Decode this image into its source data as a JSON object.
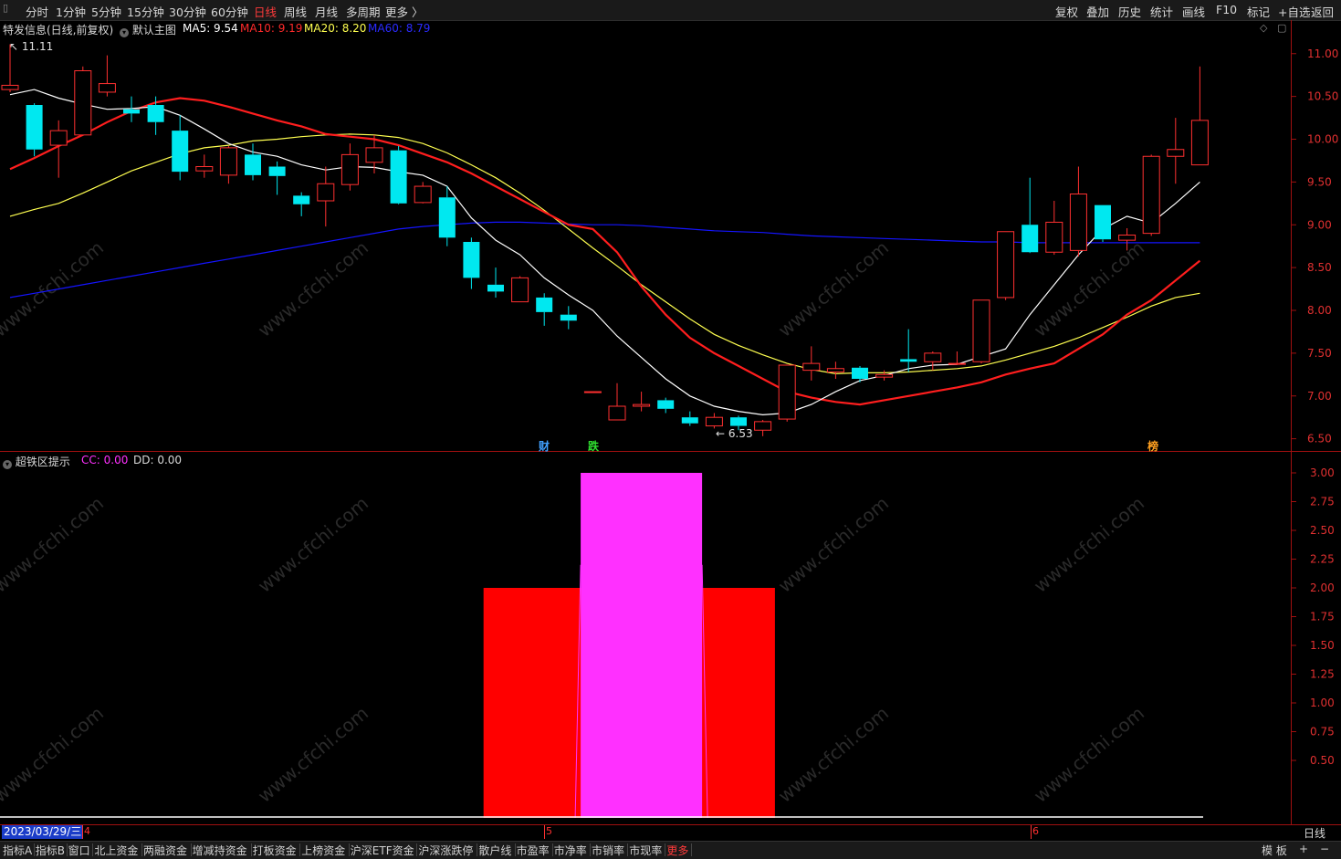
{
  "colors": {
    "up": "#ff3030",
    "down": "#00e8f0",
    "ma5": "#ffffff",
    "ma10": "#ff1e1e",
    "ma20": "#ffff50",
    "ma60": "#1414ff",
    "cc": "#ff30ff",
    "dd": "#ff0000",
    "axis": "#a01010",
    "bg": "#000000"
  },
  "toolbar": {
    "menu_icon": "menu-icon",
    "periods": [
      "分时",
      "1分钟",
      "5分钟",
      "15分钟",
      "30分钟",
      "60分钟",
      "日线",
      "周线",
      "月线",
      "多周期",
      "更多 〉"
    ],
    "active_period": "日线",
    "right_items": [
      "复权",
      "叠加",
      "历史",
      "统计",
      "画线",
      "F10",
      "标记",
      "+自选",
      "返回"
    ]
  },
  "main_chart": {
    "stock_title": "特发信息(日线,前复权)",
    "template_label": "默认主图",
    "ma5": "MA5: 9.54",
    "ma10": "MA10: 9.19",
    "ma20": "MA20: 8.20",
    "ma60": "MA60: 8.79",
    "high_marker": "11.11",
    "low_marker": "6.53",
    "y_ticks": [
      "11.00",
      "10.50",
      "10.00",
      "9.50",
      "9.00",
      "8.50",
      "8.00",
      "7.50",
      "7.00",
      "6.50"
    ],
    "y_tick_values": [
      11.0,
      10.5,
      10.0,
      9.5,
      9.0,
      8.5,
      8.0,
      7.5,
      7.0,
      6.5
    ],
    "event_tags": [
      {
        "text": "财",
        "color": "#40a0ff"
      },
      {
        "text": "跌",
        "color": "#30e030"
      },
      {
        "text": "榜",
        "color": "#ffa020"
      }
    ]
  },
  "sub_chart": {
    "title": "超铁区提示",
    "cc_label": "CC: 0.00",
    "dd_label": "DD: 0.00",
    "y_ticks": [
      "3.00",
      "2.75",
      "2.50",
      "2.25",
      "2.00",
      "1.75",
      "1.50",
      "1.25",
      "1.00",
      "0.75",
      "0.50"
    ],
    "y_tick_values": [
      3.0,
      2.75,
      2.5,
      2.25,
      2.0,
      1.75,
      1.5,
      1.25,
      1.0,
      0.75,
      0.5
    ]
  },
  "chart_data": {
    "type": "candlestick",
    "candles": [
      [
        10.58,
        10.63,
        11.11,
        10.55
      ],
      [
        10.4,
        9.88,
        10.42,
        9.8
      ],
      [
        9.93,
        10.1,
        10.22,
        9.55
      ],
      [
        10.05,
        10.8,
        10.85,
        10.05
      ],
      [
        10.55,
        10.65,
        10.98,
        10.5
      ],
      [
        10.35,
        10.3,
        10.5,
        10.2
      ],
      [
        10.4,
        10.2,
        10.5,
        10.05
      ],
      [
        10.1,
        9.62,
        10.28,
        9.52
      ],
      [
        9.63,
        9.68,
        9.82,
        9.55
      ],
      [
        9.58,
        9.9,
        9.92,
        9.48
      ],
      [
        9.82,
        9.58,
        9.95,
        9.52
      ],
      [
        9.68,
        9.57,
        9.74,
        9.35
      ],
      [
        9.34,
        9.24,
        9.38,
        9.1
      ],
      [
        9.28,
        9.48,
        9.68,
        8.98
      ],
      [
        9.47,
        9.82,
        9.95,
        9.4
      ],
      [
        9.73,
        9.9,
        10.05,
        9.6
      ],
      [
        9.87,
        9.25,
        9.92,
        9.24
      ],
      [
        9.26,
        9.45,
        9.5,
        9.25
      ],
      [
        9.32,
        8.85,
        9.45,
        8.75
      ],
      [
        8.8,
        8.38,
        8.85,
        8.25
      ],
      [
        8.3,
        8.22,
        8.5,
        8.15
      ],
      [
        8.1,
        8.38,
        8.4,
        8.1
      ],
      [
        8.15,
        7.98,
        8.2,
        7.82
      ],
      [
        7.95,
        7.88,
        8.05,
        7.78
      ],
      [
        7.05,
        7.05,
        7.05,
        7.05
      ],
      [
        6.72,
        6.88,
        7.15,
        6.72
      ],
      [
        6.88,
        6.9,
        7.05,
        6.82
      ],
      [
        6.95,
        6.85,
        6.98,
        6.8
      ],
      [
        6.75,
        6.68,
        6.82,
        6.65
      ],
      [
        6.65,
        6.75,
        6.8,
        6.62
      ],
      [
        6.75,
        6.65,
        6.77,
        6.6
      ],
      [
        6.6,
        6.7,
        6.72,
        6.53
      ],
      [
        6.73,
        7.36,
        7.36,
        6.7
      ],
      [
        7.3,
        7.38,
        7.58,
        7.18
      ],
      [
        7.28,
        7.32,
        7.4,
        7.2
      ],
      [
        7.33,
        7.2,
        7.35,
        7.16
      ],
      [
        7.22,
        7.25,
        7.3,
        7.18
      ],
      [
        7.43,
        7.4,
        7.78,
        7.28
      ],
      [
        7.4,
        7.5,
        7.52,
        7.3
      ],
      [
        7.38,
        7.38,
        7.52,
        7.36
      ],
      [
        7.4,
        8.12,
        8.12,
        7.38
      ],
      [
        8.15,
        8.92,
        8.92,
        8.12
      ],
      [
        9.0,
        8.68,
        9.55,
        8.67
      ],
      [
        8.68,
        9.03,
        9.28,
        8.65
      ],
      [
        8.7,
        9.36,
        9.68,
        8.63
      ],
      [
        9.23,
        8.83,
        9.23,
        8.8
      ],
      [
        8.82,
        8.88,
        8.96,
        8.7
      ],
      [
        8.9,
        9.8,
        9.82,
        8.87
      ],
      [
        9.8,
        9.88,
        10.25,
        9.48
      ],
      [
        9.7,
        10.22,
        10.85,
        9.7
      ]
    ],
    "ma5": [
      10.52,
      10.58,
      10.48,
      10.41,
      10.35,
      10.36,
      10.38,
      10.28,
      10.12,
      9.95,
      9.85,
      9.8,
      9.7,
      9.64,
      9.68,
      9.67,
      9.62,
      9.58,
      9.45,
      9.08,
      8.82,
      8.65,
      8.38,
      8.18,
      8.0,
      7.7,
      7.45,
      7.2,
      7.0,
      6.88,
      6.82,
      6.78,
      6.8,
      6.9,
      7.05,
      7.18,
      7.24,
      7.32,
      7.36,
      7.37,
      7.46,
      7.55,
      7.95,
      8.3,
      8.65,
      8.95,
      9.1,
      9.02,
      9.25,
      9.5
    ],
    "ma10": [
      9.65,
      9.78,
      9.92,
      10.05,
      10.2,
      10.33,
      10.43,
      10.48,
      10.45,
      10.38,
      10.3,
      10.22,
      10.15,
      10.06,
      10.03,
      10.0,
      9.93,
      9.83,
      9.73,
      9.6,
      9.45,
      9.3,
      9.15,
      9.0,
      8.95,
      8.68,
      8.28,
      7.95,
      7.68,
      7.5,
      7.35,
      7.2,
      7.05,
      6.98,
      6.93,
      6.9,
      6.95,
      7.0,
      7.05,
      7.1,
      7.16,
      7.25,
      7.32,
      7.38,
      7.55,
      7.72,
      7.95,
      8.12,
      8.35,
      8.58
    ],
    "ma20": [
      9.1,
      9.18,
      9.25,
      9.37,
      9.5,
      9.63,
      9.73,
      9.83,
      9.9,
      9.93,
      9.98,
      10.0,
      10.03,
      10.05,
      10.06,
      10.05,
      10.02,
      9.95,
      9.84,
      9.7,
      9.55,
      9.37,
      9.17,
      8.95,
      8.73,
      8.52,
      8.3,
      8.1,
      7.9,
      7.72,
      7.59,
      7.48,
      7.38,
      7.31,
      7.26,
      7.27,
      7.27,
      7.28,
      7.3,
      7.32,
      7.35,
      7.42,
      7.5,
      7.58,
      7.68,
      7.8,
      7.92,
      8.05,
      8.15,
      8.2
    ],
    "ma60": [
      8.15,
      8.2,
      8.25,
      8.3,
      8.35,
      8.4,
      8.45,
      8.5,
      8.55,
      8.6,
      8.65,
      8.7,
      8.75,
      8.8,
      8.85,
      8.9,
      8.95,
      8.98,
      9.0,
      9.02,
      9.03,
      9.03,
      9.02,
      9.01,
      9.0,
      9.0,
      8.99,
      8.97,
      8.95,
      8.93,
      8.92,
      8.91,
      8.89,
      8.87,
      8.86,
      8.85,
      8.84,
      8.83,
      8.82,
      8.81,
      8.8,
      8.8,
      8.79,
      8.79,
      8.79,
      8.79,
      8.79,
      8.79,
      8.79,
      8.79
    ],
    "cc": [
      0,
      0,
      0,
      0,
      0,
      0,
      0,
      0,
      0,
      0,
      0,
      0,
      0,
      0,
      0,
      0,
      0,
      0,
      0,
      0,
      0,
      0,
      0,
      0,
      3,
      3,
      3,
      3,
      3,
      0,
      0,
      0,
      0,
      0,
      0,
      0,
      0,
      0,
      0,
      0,
      0,
      0,
      0,
      0,
      0,
      0,
      0,
      0,
      0,
      0
    ],
    "dd": [
      0,
      0,
      0,
      0,
      0,
      0,
      0,
      0,
      0,
      0,
      0,
      0,
      0,
      0,
      0,
      0,
      0,
      0,
      0,
      0,
      2,
      2,
      2,
      2,
      2,
      2,
      2,
      2,
      2,
      2,
      2,
      2,
      0,
      0,
      0,
      0,
      0,
      0,
      0,
      0,
      0,
      0,
      0,
      0,
      0,
      0,
      0,
      0,
      0,
      0
    ],
    "ylim": [
      6.4,
      11.2
    ],
    "sub_ylim": [
      0,
      3.0
    ]
  },
  "date_axis": {
    "current_date": "2023/03/29/三",
    "month_labels": [
      "4",
      "5",
      "6"
    ],
    "period_label": "日线"
  },
  "bottom_tabs": [
    "指标A",
    "指标B",
    "窗口",
    "北上资金",
    "两融资金",
    "增减持资金",
    "打板资金",
    "上榜资金",
    "沪深ETF资金",
    "沪深涨跌停",
    "散户线",
    "市盈率",
    "市净率",
    "市销率",
    "市现率",
    "更多"
  ],
  "bottom_right": [
    "模 板",
    "+",
    "−"
  ],
  "watermark": "www.cfchi.com"
}
